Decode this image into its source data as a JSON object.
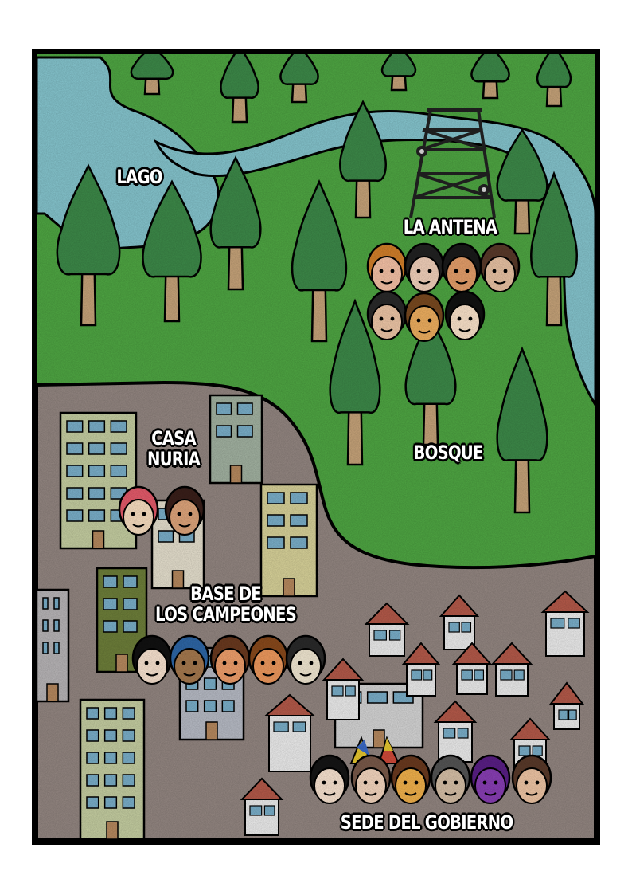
{
  "map": {
    "labels": {
      "lake": "LAGO",
      "antenna": "LA ANTENA",
      "forest": "BOSQUE",
      "casa_line1": "CASA",
      "casa_line2": "NURIA",
      "base_line1": "BASE DE",
      "base_line2": "LOS CAMPEONES",
      "government": "SEDE DEL GOBIERNO"
    },
    "colors": {
      "grass": "#4fa743",
      "water": "#86c6cf",
      "ground": "#948782",
      "tree_foliage": "#3d8a49",
      "tree_trunk": "#c7a47a",
      "building": "#c6cfa2",
      "window": "#7bb0cb",
      "roof": "#b55a4a",
      "outline": "#000000"
    },
    "groups": {
      "antenna": {
        "members": [
          {
            "name": "orange-goggles",
            "skin": "#f7c3a7",
            "hair": "#d4802a"
          },
          {
            "name": "messy-hair",
            "skin": "#f4d2bc",
            "hair": "#222222"
          },
          {
            "name": "sunglasses",
            "skin": "#e7a06b",
            "hair": "#1a1a1a"
          },
          {
            "name": "glasses-woman",
            "skin": "#eac4a5",
            "hair": "#5a3a2a"
          },
          {
            "name": "long-hair-man",
            "skin": "#f0c8a8",
            "hair": "#2a2a2a"
          },
          {
            "name": "glasses-bearded",
            "skin": "#f0b060",
            "hair": "#7a4a20"
          },
          {
            "name": "smiling-woman",
            "skin": "#fde5cc",
            "hair": "#111111"
          }
        ]
      },
      "casa": {
        "members": [
          {
            "name": "flower-crown",
            "skin": "#fbe0c2",
            "hair": "#e65b6b"
          },
          {
            "name": "dark-hair-woman",
            "skin": "#e0a67c",
            "hair": "#3a1f1a"
          }
        ]
      },
      "base": {
        "members": [
          {
            "name": "angry-woman",
            "skin": "#fbe5d2",
            "hair": "#111111"
          },
          {
            "name": "bandana-man",
            "skin": "#a77a4f",
            "hair": "#2e67a7"
          },
          {
            "name": "short-hair",
            "skin": "#f1a06c",
            "hair": "#6b3a1f"
          },
          {
            "name": "serious-man",
            "skin": "#f09a5e",
            "hair": "#8a4a1c"
          },
          {
            "name": "glasses-pale",
            "skin": "#f4ead4",
            "hair": "#2a2a2a"
          }
        ]
      },
      "government": {
        "members": [
          {
            "name": "frowning-woman",
            "skin": "#fbe5d2",
            "hair": "#151515"
          },
          {
            "name": "freckles-glasses",
            "skin": "#f7d8c0",
            "hair": "#7a5a4a"
          },
          {
            "name": "glasses-man",
            "skin": "#f3b24c",
            "hair": "#6b3a1f"
          },
          {
            "name": "cap-bearded",
            "skin": "#d8c1a8",
            "hair": "#555555"
          },
          {
            "name": "purple-devil",
            "skin": "#8a3fb6",
            "hair": "#5a1f86"
          },
          {
            "name": "tired-man",
            "skin": "#f1c7a6",
            "hair": "#5a3a2a"
          }
        ]
      }
    }
  }
}
